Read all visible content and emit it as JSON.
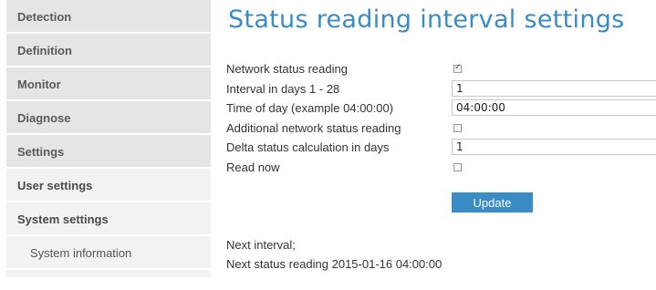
{
  "sidebar": {
    "items": [
      {
        "label": "Detection"
      },
      {
        "label": "Definition"
      },
      {
        "label": "Monitor"
      },
      {
        "label": "Diagnose"
      },
      {
        "label": "Settings"
      },
      {
        "label": "User settings"
      },
      {
        "label": "System settings"
      },
      {
        "label": "System information"
      }
    ]
  },
  "page": {
    "title": "Status reading interval settings"
  },
  "form": {
    "network_status_reading": {
      "label": "Network status reading",
      "checked": true
    },
    "interval_days": {
      "label": "Interval in days 1 - 28",
      "value": "1"
    },
    "time_of_day": {
      "label": "Time of day (example 04:00:00)",
      "value": "04:00:00"
    },
    "additional_reading": {
      "label": "Additional network status reading",
      "checked": false
    },
    "delta_days": {
      "label": "Delta status calculation in days",
      "value": "1"
    },
    "read_now": {
      "label": "Read now",
      "checked": false
    },
    "update_label": "Update"
  },
  "next": {
    "label": "Next interval;",
    "value": "Next status reading 2015-01-16 04:00:00"
  },
  "colors": {
    "accent": "#3a8cc4",
    "nav_bg": "#e5e5e5",
    "nav_bg_light": "#f2f2f2"
  }
}
